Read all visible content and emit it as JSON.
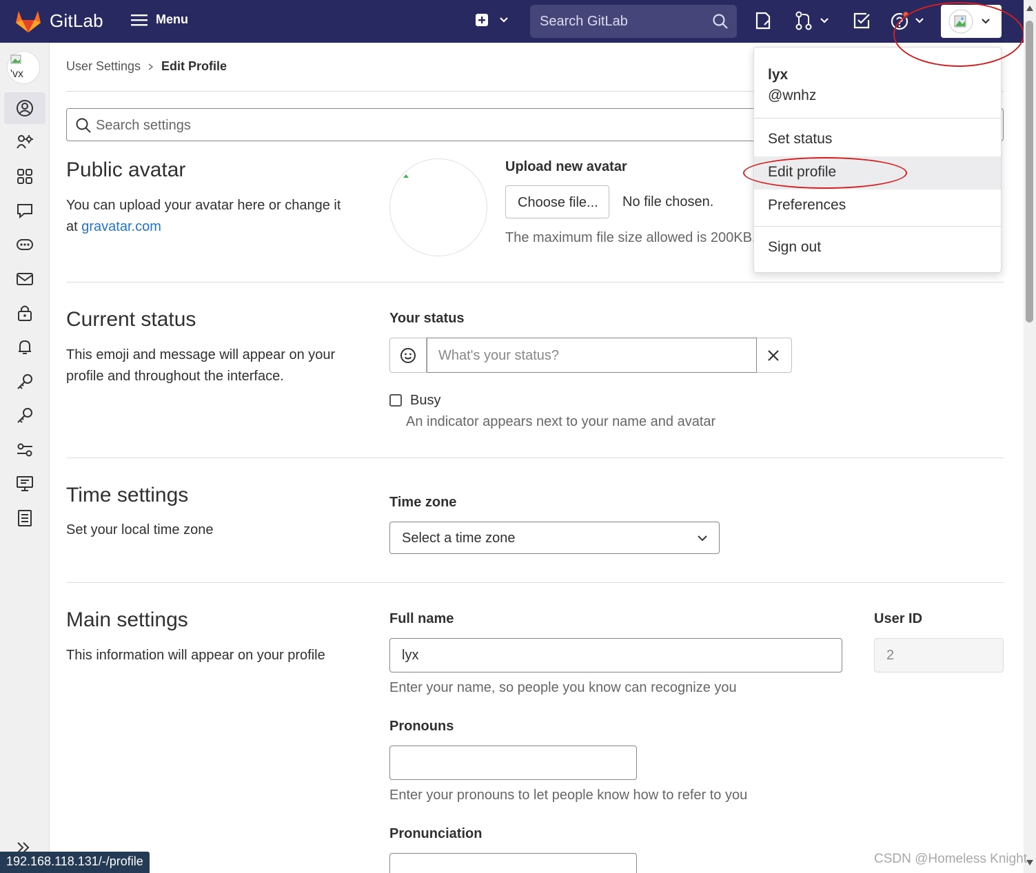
{
  "header": {
    "brand": "GitLab",
    "menu_label": "Menu",
    "search_placeholder": "Search GitLab",
    "colors": {
      "navbar": "#292961",
      "logo_orange": "#fc6d26"
    }
  },
  "sidebar": {
    "avatar_text": "'vx",
    "items": [
      "profile",
      "account",
      "applications",
      "chat",
      "access-tokens",
      "emails",
      "password",
      "notifications",
      "ssh-keys",
      "gpg-keys",
      "preferences",
      "active-sessions",
      "authentication-log"
    ]
  },
  "breadcrumb": {
    "parent": "User Settings",
    "current": "Edit Profile"
  },
  "search_settings": {
    "placeholder": "Search settings"
  },
  "public_avatar": {
    "title": "Public avatar",
    "desc_line1": "You can upload your avatar here or change it",
    "desc_prefix": "at ",
    "desc_link": "gravatar.com",
    "upload_label": "Upload new avatar",
    "choose_file": "Choose file...",
    "no_file": "No file chosen.",
    "max_size": "The maximum file size allowed is 200KB."
  },
  "current_status": {
    "title": "Current status",
    "desc_line1": "This emoji and message will appear on your",
    "desc_line2": "profile and throughout the interface.",
    "your_status": "Your status",
    "placeholder": "What's your status?",
    "busy_label": "Busy",
    "busy_help": "An indicator appears next to your name and avatar"
  },
  "time_settings": {
    "title": "Time settings",
    "desc": "Set your local time zone",
    "tz_label": "Time zone",
    "tz_value": "Select a time zone"
  },
  "main_settings": {
    "title": "Main settings",
    "desc": "This information will appear on your profile",
    "full_name_label": "Full name",
    "full_name_value": "lyx",
    "full_name_help": "Enter your name, so people you know can recognize you",
    "user_id_label": "User ID",
    "user_id_value": "2",
    "pronouns_label": "Pronouns",
    "pronouns_help": "Enter your pronouns to let people know how to refer to you",
    "pronunciation_label": "Pronunciation"
  },
  "user_menu": {
    "name": "lyx",
    "handle": "@wnhz",
    "set_status": "Set status",
    "edit_profile": "Edit profile",
    "preferences": "Preferences",
    "sign_out": "Sign out"
  },
  "status_bar": {
    "url": "192.168.118.131/-/profile"
  },
  "watermark": "CSDN @Homeless Knight"
}
